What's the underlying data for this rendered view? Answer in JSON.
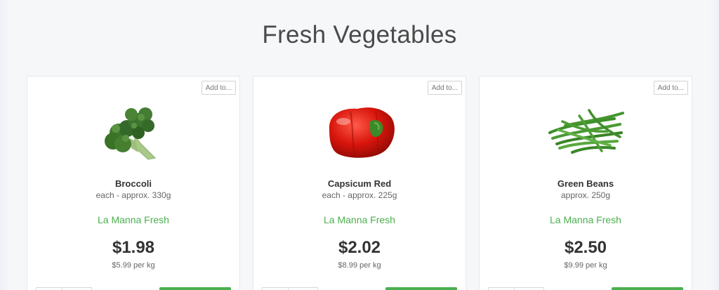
{
  "page": {
    "title": "Fresh Vegetables"
  },
  "products": [
    {
      "add_to_label": "Add to...",
      "name": "Broccoli",
      "size": "each - approx. 330g",
      "brand": "La Manna Fresh",
      "price": "$1.98",
      "unit_price": "$5.99 per kg",
      "image_icon": "broccoli-image"
    },
    {
      "add_to_label": "Add to...",
      "name": "Capsicum Red",
      "size": "each - approx. 225g",
      "brand": "La Manna Fresh",
      "price": "$2.02",
      "unit_price": "$8.99 per kg",
      "image_icon": "red-capsicum-image"
    },
    {
      "add_to_label": "Add to...",
      "name": "Green Beans",
      "size": "approx. 250g",
      "brand": "La Manna Fresh",
      "price": "$2.50",
      "unit_price": "$9.99 per kg",
      "image_icon": "green-beans-image"
    }
  ],
  "colors": {
    "brand_green": "#4caf50",
    "title_gray": "#4a4a4a",
    "background": "#f6f7f9"
  }
}
